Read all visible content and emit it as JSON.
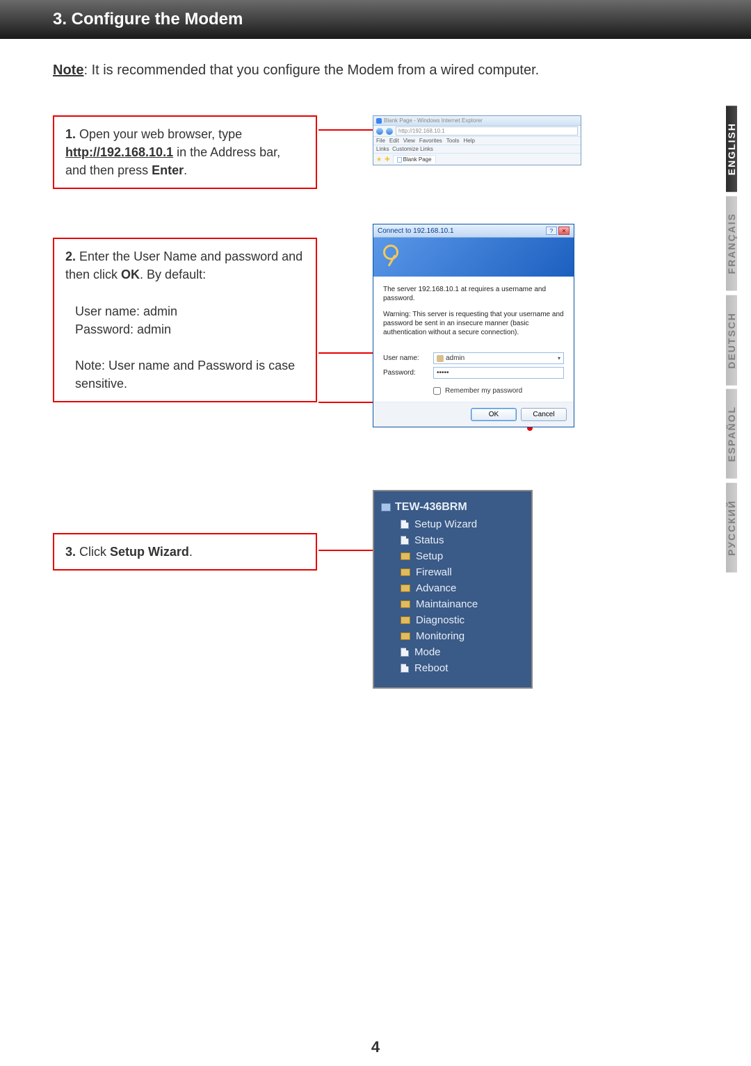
{
  "header": {
    "title": "3. Configure the Modem"
  },
  "main_note": {
    "label": "Note",
    "text": ": It is recommended that you configure the Modem from a wired computer."
  },
  "steps": {
    "s1": {
      "num": "1.",
      "pre": " Open your web browser, type ",
      "url": "http://192.168.10.1",
      "mid": " in the Address bar, and then press ",
      "bold": "Enter",
      "end": "."
    },
    "s2": {
      "num": "2.",
      "line1a": " Enter the User Name and password and then click ",
      "line1bold": "OK",
      "line1b": ".  By default:",
      "user_label": "User name: admin",
      "pass_label": "Password: admin",
      "note": "Note: User name and Password is case sensitive."
    },
    "s3": {
      "num": "3.",
      "pre": " Click ",
      "bold": "Setup Wizard",
      "end": "."
    }
  },
  "browser": {
    "title": "Blank Page - Windows Internet Explorer",
    "url": "http://192.168.10.1",
    "menu": [
      "File",
      "Edit",
      "View",
      "Favorites",
      "Tools",
      "Help"
    ],
    "links_label": "Links",
    "customize": "Customize Links",
    "tab": "Blank Page"
  },
  "auth": {
    "title": "Connect to 192.168.10.1",
    "msg1": "The server 192.168.10.1 at  requires a username and password.",
    "msg2": "Warning: This server is requesting that your username and password be sent in an insecure manner (basic authentication without a secure connection).",
    "user_label": "User name:",
    "user_value": "admin",
    "pass_label": "Password:",
    "pass_value": "•••••",
    "remember": "Remember my password",
    "ok": "OK",
    "cancel": "Cancel",
    "help_btn": "?"
  },
  "menu": {
    "root": "TEW-436BRM",
    "items": [
      {
        "label": "Setup Wizard",
        "type": "page"
      },
      {
        "label": "Status",
        "type": "page"
      },
      {
        "label": "Setup",
        "type": "folder"
      },
      {
        "label": "Firewall",
        "type": "folder"
      },
      {
        "label": "Advance",
        "type": "folder"
      },
      {
        "label": "Maintainance",
        "type": "folder"
      },
      {
        "label": "Diagnostic",
        "type": "folder"
      },
      {
        "label": "Monitoring",
        "type": "folder"
      },
      {
        "label": "Mode",
        "type": "page"
      },
      {
        "label": "Reboot",
        "type": "page"
      }
    ]
  },
  "languages": [
    {
      "label": "ENGLISH",
      "active": true
    },
    {
      "label": "FRANÇAIS",
      "active": false
    },
    {
      "label": "DEUTSCH",
      "active": false
    },
    {
      "label": "ESPAÑOL",
      "active": false
    },
    {
      "label": "РУССКИЙ",
      "active": false
    }
  ],
  "page_number": "4"
}
